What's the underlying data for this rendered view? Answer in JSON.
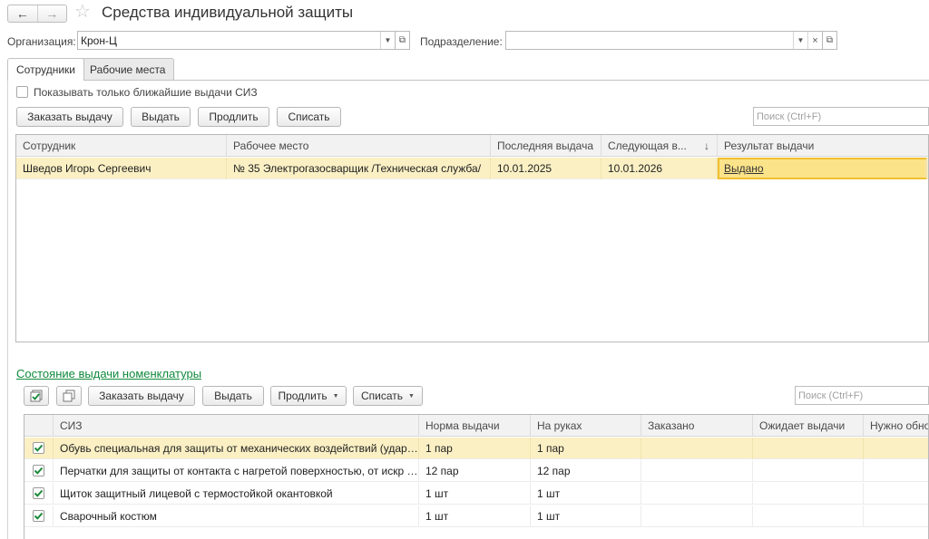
{
  "header": {
    "title": "Средства индивидуальной защиты",
    "back_icon": "arrow-left-icon",
    "forward_icon": "arrow-right-icon",
    "favorite_icon": "star-icon",
    "back_glyph": "←",
    "forward_glyph": "→",
    "star_glyph": "☆"
  },
  "filters": {
    "organization_label": "Организация:",
    "organization_value": "Крон-Ц",
    "subdivision_label": "Подразделение:",
    "subdivision_value": ""
  },
  "tabs": [
    {
      "label": "Сотрудники",
      "active": true
    },
    {
      "label": "Рабочие места",
      "active": false
    }
  ],
  "employees": {
    "show_nearest_label": "Показывать только ближайшие выдачи СИЗ",
    "show_nearest_checked": false,
    "buttons": {
      "order": "Заказать выдачу",
      "issue": "Выдать",
      "extend": "Продлить",
      "write_off": "Списать"
    },
    "search_placeholder": "Поиск (Ctrl+F)",
    "columns": [
      "Сотрудник",
      "Рабочее место",
      "Последняя выдача",
      "Следующая в...",
      "Результат выдачи"
    ],
    "sort_glyph": "↓",
    "rows": [
      {
        "employee": "Шведов Игорь Сергеевич",
        "workplace": "№ 35 Электрогазосварщик /Техническая служба/",
        "last_issue": "10.01.2025",
        "next_issue": "10.01.2026",
        "result": "Выдано"
      }
    ]
  },
  "nomenclature": {
    "title": "Состояние выдачи номенклатуры",
    "buttons": {
      "order": "Заказать выдачу",
      "issue": "Выдать",
      "extend": "Продлить",
      "write_off": "Списать"
    },
    "search_placeholder": "Поиск (Ctrl+F)",
    "columns": [
      "СИЗ",
      "Норма выдачи",
      "На руках",
      "Заказано",
      "Ожидает выдачи",
      "Нужно обновить"
    ],
    "rows": [
      {
        "checked": true,
        "name": "Обувь специальная для защиты от механических воздействий (ударов) в носочной части",
        "norm": "1 пар",
        "on_hand": "1 пар",
        "ordered": "",
        "waiting": "",
        "update": ""
      },
      {
        "checked": true,
        "name": "Перчатки для защиты от контакта с нагретой поверхностью, от искр и брызг",
        "norm": "12 пар",
        "on_hand": "12 пар",
        "ordered": "",
        "waiting": "",
        "update": ""
      },
      {
        "checked": true,
        "name": "Щиток защитный лицевой с термостойкой окантовкой",
        "norm": "1 шт",
        "on_hand": "1 шт",
        "ordered": "",
        "waiting": "",
        "update": ""
      },
      {
        "checked": true,
        "name": "Сварочный костюм",
        "norm": "1 шт",
        "on_hand": "1 шт",
        "ordered": "",
        "waiting": "",
        "update": ""
      }
    ]
  },
  "colors": {
    "accent_green": "#0f8a3c",
    "selected_row": "#fbf0c4",
    "focused_cell": "#fbe38a"
  }
}
